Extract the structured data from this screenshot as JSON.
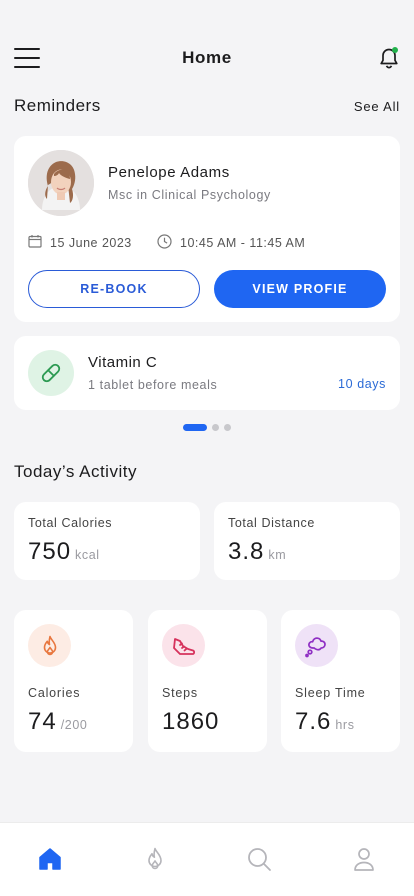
{
  "header": {
    "title": "Home"
  },
  "reminders": {
    "title": "Reminders",
    "see_all": "See All",
    "appointment": {
      "name": "Penelope Adams",
      "role": "Msc in Clinical Psychology",
      "date": "15 June 2023",
      "time": "10:45 AM - 11:45 AM",
      "rebook_label": "RE-BOOK",
      "view_label": "VIEW PROFIE"
    },
    "medication": {
      "name": "Vitamin C",
      "instruction": "1 tablet before meals",
      "duration": "10 days"
    },
    "pager": {
      "total": 3,
      "active": 1
    }
  },
  "activity": {
    "title": "Today’s Activity",
    "total_calories": {
      "label": "Total Calories",
      "value": "750",
      "unit": "kcal"
    },
    "total_distance": {
      "label": "Total Distance",
      "value": "3.8",
      "unit": "km"
    },
    "calories": {
      "label": "Calories",
      "value": "74",
      "unit": "/200"
    },
    "steps": {
      "label": "Steps",
      "value": "1860"
    },
    "sleep": {
      "label": "Sleep Time",
      "value": "7.6",
      "unit": "hrs"
    }
  },
  "tabs": [
    {
      "name": "home",
      "icon": "home-icon",
      "active": true
    },
    {
      "name": "activity",
      "icon": "flame-icon",
      "active": false
    },
    {
      "name": "search",
      "icon": "search-icon",
      "active": false
    },
    {
      "name": "profile",
      "icon": "user-icon",
      "active": false
    }
  ],
  "colors": {
    "accent": "#1f66f2",
    "outline_accent": "#2a5bd7",
    "notification_dot": "#22b14c"
  }
}
